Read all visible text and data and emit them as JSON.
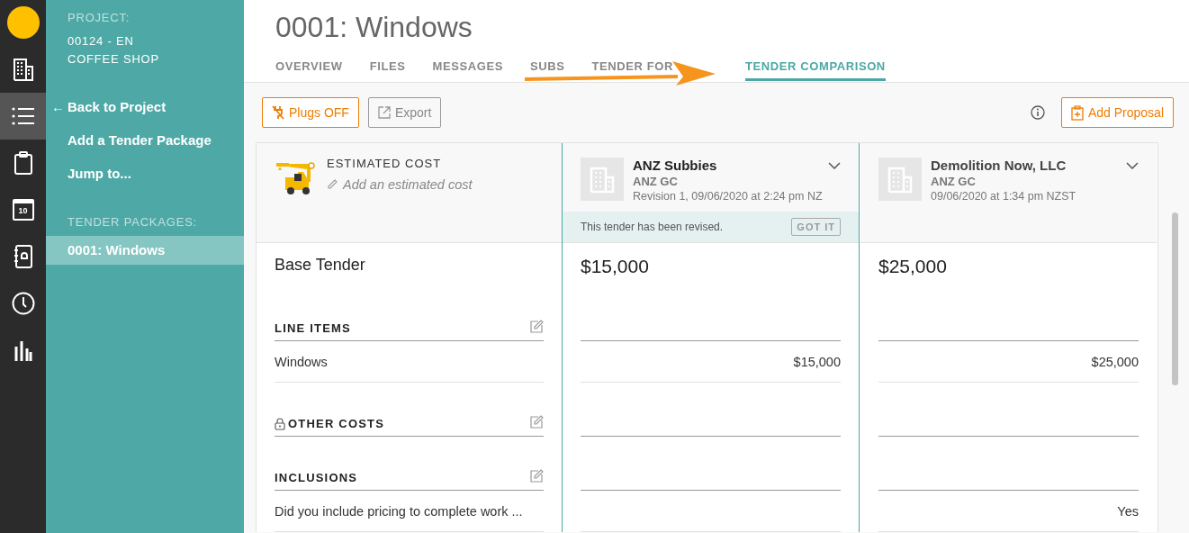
{
  "rail": [
    {
      "kind": "building",
      "selected": false
    },
    {
      "kind": "list",
      "selected": true
    },
    {
      "kind": "clipboard",
      "selected": false
    },
    {
      "kind": "calendar",
      "selected": false,
      "day": "10"
    },
    {
      "kind": "contacts",
      "selected": false
    },
    {
      "kind": "clock",
      "selected": false
    },
    {
      "kind": "chart",
      "selected": false
    }
  ],
  "sidebar": {
    "project_label": "PROJECT:",
    "project_name": "00124 - EN COFFEE SHOP",
    "back": {
      "arrow": "←",
      "label": "Back to Project"
    },
    "links": [
      "Add a Tender Package",
      "Jump to..."
    ],
    "packages_label": "TENDER PACKAGES:",
    "packages": [
      {
        "label": "0001: Windows",
        "selected": true
      }
    ]
  },
  "header": {
    "title": "0001: Windows",
    "tabs": [
      {
        "label": "OVERVIEW",
        "selected": false
      },
      {
        "label": "FILES",
        "selected": false
      },
      {
        "label": "MESSAGES",
        "selected": false
      },
      {
        "label": "SUBS",
        "selected": false
      },
      {
        "label": "TENDER FOR",
        "selected": false
      },
      {
        "label": "TENDER COMPARISON",
        "selected": true
      }
    ]
  },
  "toolbar": {
    "plugs": "Plugs OFF",
    "export": "Export",
    "add": "Add Proposal"
  },
  "estimate": {
    "label": "ESTIMATED COST",
    "placeholder": "Add an estimated cost"
  },
  "bidders": [
    {
      "name": "ANZ Subbies",
      "company": "ANZ GC",
      "date": "Revision 1, 09/06/2020 at 2:24 pm NZ",
      "selected": true,
      "notice": {
        "text": "This tender has been revised.",
        "button": "GOT IT"
      },
      "base": "$15,000"
    },
    {
      "name": "Demolition Now, LLC",
      "company": "ANZ GC",
      "date": "09/06/2020 at 1:34 pm NZST",
      "selected": false,
      "base": "$25,000"
    }
  ],
  "base_label": "Base Tender",
  "sections": [
    {
      "title": "LINE ITEMS",
      "locked": false,
      "items": [
        {
          "label": "Windows",
          "values": {
            "0": "$15,000",
            "1": "$25,000"
          }
        }
      ]
    },
    {
      "title": "OTHER COSTS",
      "locked": true
    },
    {
      "title": "INCLUSIONS",
      "locked": false,
      "items": [
        {
          "label": "Did you include pricing to complete work ...",
          "values": {
            "1": "Yes"
          }
        }
      ]
    }
  ]
}
